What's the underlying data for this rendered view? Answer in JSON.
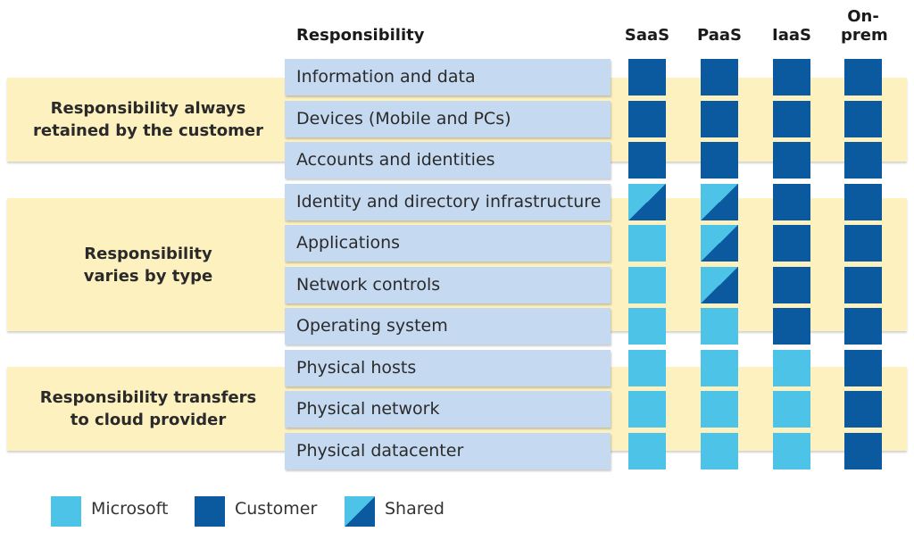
{
  "header": {
    "responsibility": "Responsibility",
    "columns": [
      "SaaS",
      "PaaS",
      "IaaS",
      "On-prem"
    ]
  },
  "groups": [
    {
      "label": "Responsibility always retained by the customer"
    },
    {
      "label": "Responsibility varies by type"
    },
    {
      "label": "Responsibility transfers to cloud provider"
    }
  ],
  "rows": [
    {
      "label": "Information and data",
      "cells": [
        "customer",
        "customer",
        "customer",
        "customer"
      ]
    },
    {
      "label": "Devices (Mobile and PCs)",
      "cells": [
        "customer",
        "customer",
        "customer",
        "customer"
      ]
    },
    {
      "label": "Accounts and identities",
      "cells": [
        "customer",
        "customer",
        "customer",
        "customer"
      ]
    },
    {
      "label": "Identity and directory infrastructure",
      "cells": [
        "shared",
        "shared",
        "customer",
        "customer"
      ]
    },
    {
      "label": "Applications",
      "cells": [
        "microsoft",
        "shared",
        "customer",
        "customer"
      ]
    },
    {
      "label": "Network controls",
      "cells": [
        "microsoft",
        "shared",
        "customer",
        "customer"
      ]
    },
    {
      "label": "Operating system",
      "cells": [
        "microsoft",
        "microsoft",
        "customer",
        "customer"
      ]
    },
    {
      "label": "Physical hosts",
      "cells": [
        "microsoft",
        "microsoft",
        "microsoft",
        "customer"
      ]
    },
    {
      "label": "Physical network",
      "cells": [
        "microsoft",
        "microsoft",
        "microsoft",
        "customer"
      ]
    },
    {
      "label": "Physical datacenter",
      "cells": [
        "microsoft",
        "microsoft",
        "microsoft",
        "customer"
      ]
    }
  ],
  "legend": [
    {
      "key": "microsoft",
      "label": "Microsoft"
    },
    {
      "key": "customer",
      "label": "Customer"
    },
    {
      "key": "shared",
      "label": "Shared"
    }
  ],
  "colors": {
    "microsoft": "#4dc3e8",
    "customer": "#0b5aa0",
    "band": "#fdf1c0",
    "row": "#c5d9f1"
  }
}
